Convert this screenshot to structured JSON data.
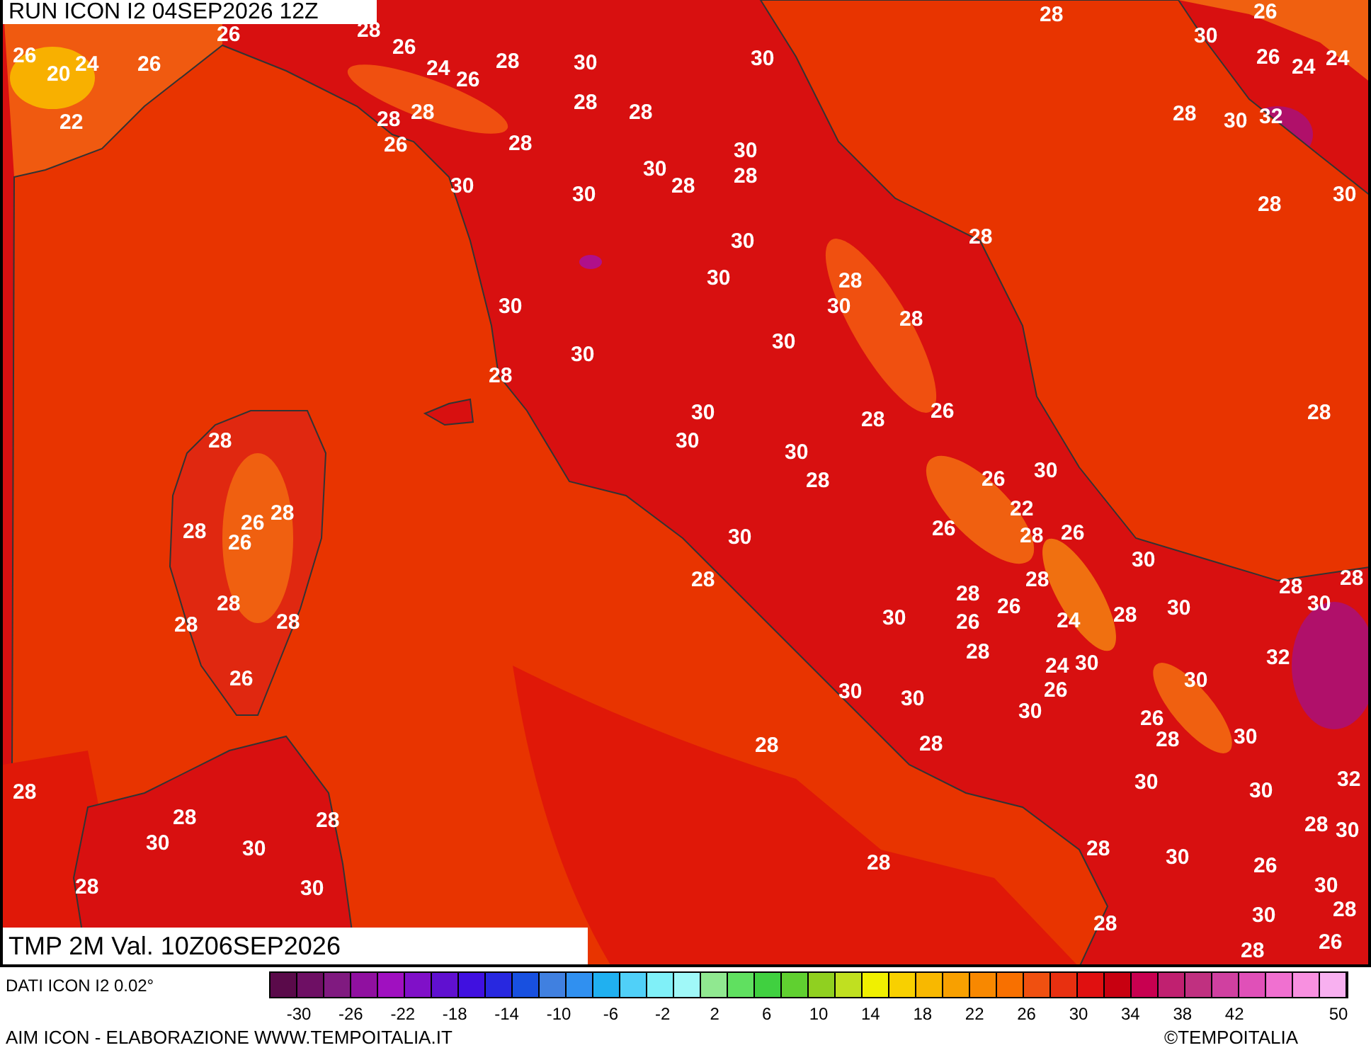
{
  "run_title": "RUN ICON I2 04SEP2026 12Z",
  "map_labels": [
    "26",
    "28",
    "28",
    "30",
    "26",
    "26",
    "20",
    "24",
    "26",
    "26",
    "24",
    "26",
    "28",
    "30",
    "30",
    "26",
    "24",
    "24",
    "22",
    "28",
    "26",
    "28",
    "28",
    "28",
    "28",
    "30",
    "28",
    "30",
    "32",
    "30",
    "30",
    "30",
    "28",
    "28",
    "28",
    "30",
    "30",
    "30",
    "30",
    "30",
    "28",
    "28",
    "28",
    "28",
    "30",
    "30",
    "30",
    "28",
    "26",
    "28",
    "28",
    "30",
    "30",
    "28",
    "26",
    "30",
    "28",
    "26",
    "26",
    "28",
    "30",
    "26",
    "22",
    "28",
    "26",
    "28",
    "28",
    "28",
    "28",
    "30",
    "28",
    "26",
    "26",
    "28",
    "24",
    "28",
    "30",
    "30",
    "28",
    "30",
    "28",
    "26",
    "30",
    "30",
    "28",
    "30",
    "24",
    "26",
    "30",
    "26",
    "30",
    "32",
    "28",
    "28",
    "28",
    "30",
    "28",
    "30",
    "30",
    "32",
    "30",
    "28",
    "30",
    "28",
    "28",
    "28",
    "30",
    "26",
    "28",
    "30",
    "28",
    "30",
    "28",
    "28",
    "30",
    "30",
    "26",
    "28"
  ],
  "caption": "TMP 2M Val. 10Z06SEP2026",
  "legend": {
    "source": "DATI ICON I2 0.02°",
    "swatches": [
      {
        "color": "#5a0a4a"
      },
      {
        "color": "#6e0f64"
      },
      {
        "color": "#801a80"
      },
      {
        "color": "#9010a0"
      },
      {
        "color": "#a010c0"
      },
      {
        "color": "#8010c8"
      },
      {
        "color": "#6010d0"
      },
      {
        "color": "#4010e0"
      },
      {
        "color": "#2828e0"
      },
      {
        "color": "#1850e0"
      },
      {
        "color": "#4080e0"
      },
      {
        "color": "#3090f0"
      },
      {
        "color": "#20b0f0"
      },
      {
        "color": "#50d0f8"
      },
      {
        "color": "#80f0f8"
      },
      {
        "color": "#a0f8f8"
      },
      {
        "color": "#90e890"
      },
      {
        "color": "#60e060"
      },
      {
        "color": "#40d040"
      },
      {
        "color": "#60d030"
      },
      {
        "color": "#90d020"
      },
      {
        "color": "#c0e020"
      },
      {
        "color": "#f0f000"
      },
      {
        "color": "#f8d000"
      },
      {
        "color": "#f8b800"
      },
      {
        "color": "#f8a000"
      },
      {
        "color": "#f88800"
      },
      {
        "color": "#f87000"
      },
      {
        "color": "#f05010"
      },
      {
        "color": "#e83010"
      },
      {
        "color": "#e01010"
      },
      {
        "color": "#c80010"
      },
      {
        "color": "#c80050"
      },
      {
        "color": "#c02070"
      },
      {
        "color": "#c03080"
      },
      {
        "color": "#d040a0"
      },
      {
        "color": "#e050b8"
      },
      {
        "color": "#f070d0"
      },
      {
        "color": "#f890e0"
      },
      {
        "color": "#f8b0f0"
      }
    ],
    "ticks": [
      "-30",
      "-26",
      "-22",
      "-18",
      "-14",
      "-10",
      "-6",
      "-2",
      "2",
      "6",
      "10",
      "14",
      "18",
      "22",
      "26",
      "30",
      "34",
      "38",
      "42",
      "50"
    ]
  },
  "credit": "AIM ICON - ELABORAZIONE WWW.TEMPOITALIA.IT",
  "copyright": "©TEMPOITALIA"
}
